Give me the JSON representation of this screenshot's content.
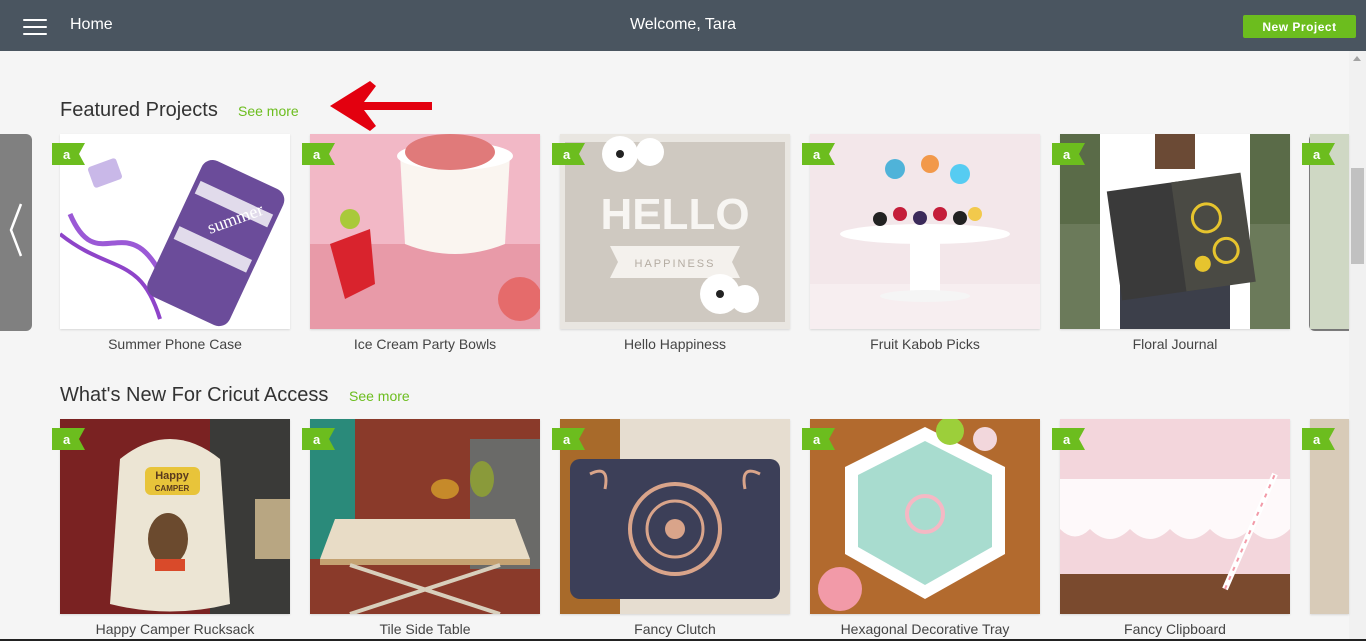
{
  "header": {
    "home_label": "Home",
    "welcome": "Welcome, Tara",
    "new_project_label": "New Project"
  },
  "sections": [
    {
      "title": "Featured Projects",
      "see_more": "See more",
      "items": [
        {
          "label": "Summer Phone Case"
        },
        {
          "label": "Ice Cream Party Bowls"
        },
        {
          "label": "Hello Happiness"
        },
        {
          "label": "Fruit Kabob Picks"
        },
        {
          "label": "Floral Journal"
        }
      ]
    },
    {
      "title": "What's New For Cricut Access",
      "see_more": "See more",
      "items": [
        {
          "label": "Happy Camper Rucksack"
        },
        {
          "label": "Tile Side Table"
        },
        {
          "label": "Fancy Clutch"
        },
        {
          "label": "Hexagonal Decorative Tray"
        },
        {
          "label": "Fancy Clipboard"
        }
      ]
    }
  ],
  "thumb_texts": {
    "phone_case": "summer",
    "hello_sign": "HELLO",
    "hello_sub": "HAPPINESS",
    "rucksack_1": "Happy",
    "rucksack_2": "CAMPER"
  },
  "colors": {
    "header_bg": "#4a5560",
    "accent_green": "#6cbd1e",
    "annotation_red": "#e3000f"
  },
  "icons": [
    "menu-icon",
    "chevron-left-icon",
    "chevron-right-icon",
    "access-badge-icon"
  ]
}
